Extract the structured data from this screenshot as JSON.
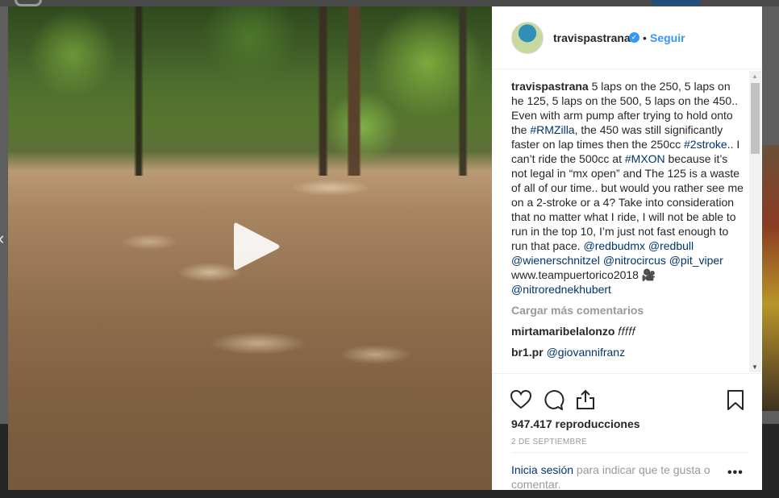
{
  "post": {
    "username": "travispastrana",
    "follow_label": "Seguir",
    "separator": "•",
    "caption": {
      "parts": [
        {
          "type": "user",
          "text": "travispastrana"
        },
        {
          "type": "text",
          "text": " 5 laps on the 250, 5 laps on he 125, 5 laps on the 500, 5 laps on the 450.. Even with arm pump after trying to hold onto the "
        },
        {
          "type": "tag",
          "text": "#RMZilla"
        },
        {
          "type": "text",
          "text": ", the 450 was still significantly faster on lap times then the 250cc "
        },
        {
          "type": "tag",
          "text": "#2stroke"
        },
        {
          "type": "text",
          "text": ".. I can’t ride the 500cc at "
        },
        {
          "type": "tag",
          "text": "#MXON"
        },
        {
          "type": "text",
          "text": " because it’s not legal in “mx open” and The 125 is a waste of all of our time.. but would you rather see me on a 2-stroke or a 4? Take into consideration that no matter what I ride, I will not be able to run in the top 10, I’m just not fast enough to run that pace. "
        },
        {
          "type": "tag",
          "text": "@redbudmx"
        },
        {
          "type": "text",
          "text": " "
        },
        {
          "type": "tag",
          "text": "@redbull"
        },
        {
          "type": "text",
          "text": " "
        },
        {
          "type": "tag",
          "text": "@wienerschnitzel"
        },
        {
          "type": "text",
          "text": " "
        },
        {
          "type": "tag",
          "text": "@nitrocircus"
        },
        {
          "type": "text",
          "text": " "
        },
        {
          "type": "tag",
          "text": "@pit_viper"
        },
        {
          "type": "text",
          "text": " www.teampuertorico2018 🎥 "
        },
        {
          "type": "tag",
          "text": "@nitrorednekhubert"
        }
      ]
    },
    "load_more_label": "Cargar más comentarios",
    "comments": [
      {
        "user": "mirtamaribelalonzo",
        "text": "𝑓𝑓𝑓𝑓𝑓",
        "mention": ""
      },
      {
        "user": "br1.pr",
        "text": "",
        "mention": "@giovannifranz"
      }
    ],
    "views": "947.417 reproducciones",
    "date": "2 DE SEPTIEMBRE",
    "login_link": "Inicia sesión",
    "login_text": " para indicar que te gusta o comentar.",
    "more_options": "•••"
  },
  "icons": {
    "play": "play-icon",
    "verified": "verified-badge-icon",
    "like": "heart-icon",
    "comment": "comment-bubble-icon",
    "share": "share-icon",
    "save": "bookmark-icon",
    "nav_prev": "chevron-left-icon"
  },
  "colors": {
    "link_blue": "#3897f0",
    "hashtag_navy": "#003569",
    "muted_gray": "#999999",
    "text_dark": "#262626"
  }
}
